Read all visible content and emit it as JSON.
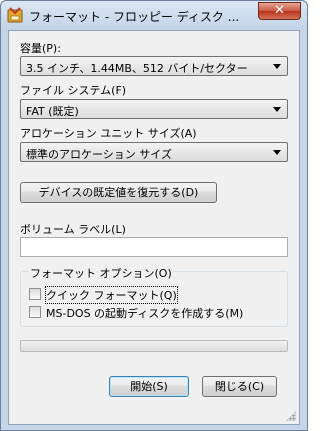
{
  "window": {
    "title": "フォーマット - フロッピー ディスク ...",
    "close_glyph": "✕",
    "icon": "format-disk-icon"
  },
  "capacity": {
    "label": "容量(P):",
    "value": "3.5 インチ、1.44MB、512 バイト/セクター"
  },
  "filesystem": {
    "label": "ファイル システム(F)",
    "value": "FAT (既定)"
  },
  "allocation": {
    "label": "アロケーション ユニット サイズ(A)",
    "value": "標準のアロケーション サイズ"
  },
  "restore_defaults_label": "デバイスの既定値を復元する(D)",
  "volume": {
    "label": "ボリューム ラベル(L)",
    "value": ""
  },
  "format_options": {
    "title": "フォーマット オプション(O)",
    "quick_format": {
      "label": "クイック フォーマット(Q)",
      "checked": false
    },
    "msdos_startup": {
      "label": "MS-DOS の起動ディスクを作成する(M)",
      "checked": false
    }
  },
  "progress": {
    "value": 0
  },
  "buttons": {
    "start": "開始(S)",
    "close": "閉じる(C)"
  },
  "colors": {
    "title_bar": "#c6d6e8",
    "close_button": "#c85a43",
    "dialog_bg": "#f0f0f0",
    "progress_fill": "#06b025"
  }
}
